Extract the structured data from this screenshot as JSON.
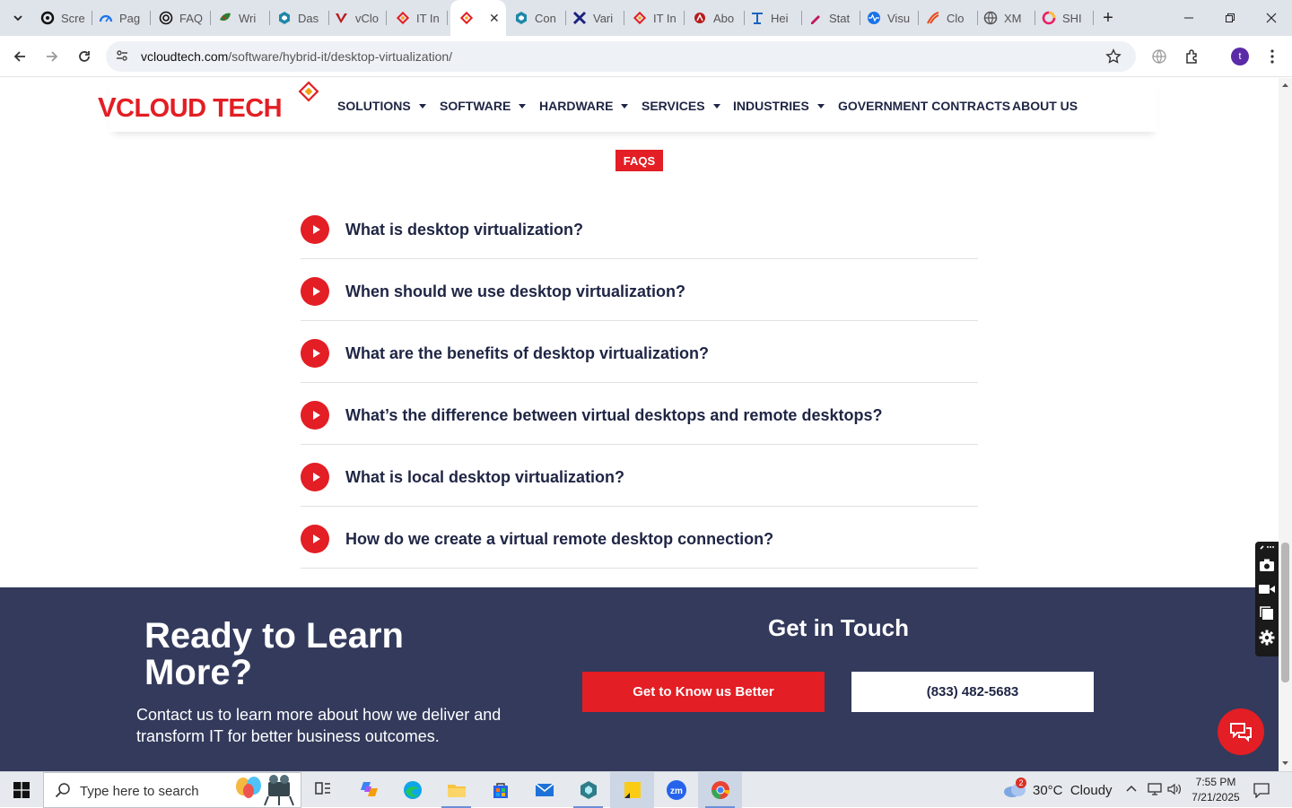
{
  "browser": {
    "tabs": [
      {
        "title": "Scre",
        "icon": "circle-ring-icon",
        "color": "#111111"
      },
      {
        "title": "Pag",
        "icon": "gauge-icon",
        "color": "#1a73e8"
      },
      {
        "title": "FAQ",
        "icon": "openai-icon",
        "color": "#111111"
      },
      {
        "title": "Wri",
        "icon": "leaf-icon",
        "color": "#2e7d32"
      },
      {
        "title": "Das",
        "icon": "hex-icon",
        "color": "#1e88a8"
      },
      {
        "title": "vClo",
        "icon": "v-logo-icon",
        "color": "#b71c1c"
      },
      {
        "title": "IT In",
        "icon": "diamond-logo-icon",
        "color": "#e31e24"
      },
      {
        "title": "",
        "icon": "diamond-logo-icon",
        "color": "#e31e24",
        "active": true
      },
      {
        "title": "Con",
        "icon": "hex-icon",
        "color": "#1e88a8"
      },
      {
        "title": "Vari",
        "icon": "x-logo-icon",
        "color": "#1a237e"
      },
      {
        "title": "IT In",
        "icon": "diamond-logo-icon",
        "color": "#e31e24"
      },
      {
        "title": "Abo",
        "icon": "brand-icon",
        "color": "#b71c1c"
      },
      {
        "title": "Hei",
        "icon": "heading-icon",
        "color": "#1565c0"
      },
      {
        "title": "Stat",
        "icon": "pen-icon",
        "color": "#c2185b"
      },
      {
        "title": "Visu",
        "icon": "pulse-icon",
        "color": "#1a73e8"
      },
      {
        "title": "Clo",
        "icon": "swoosh-icon",
        "color": "#e64a19"
      },
      {
        "title": "XM",
        "icon": "globe-icon",
        "color": "#555555"
      },
      {
        "title": "SHI",
        "icon": "ring-icon",
        "color": "#e91e63"
      }
    ],
    "close_tab_glyph": "✕",
    "new_tab_glyph": "+",
    "url_host": "vcloudtech.com",
    "url_path": "/software/hybrid-it/desktop-virtualization/",
    "profile_initial": "t"
  },
  "site": {
    "logo_text_v": "V",
    "logo_text": "CLOUD TECH",
    "nav": [
      {
        "label": "SOLUTIONS",
        "dropdown": true
      },
      {
        "label": "SOFTWARE",
        "dropdown": true
      },
      {
        "label": "HARDWARE",
        "dropdown": true
      },
      {
        "label": "SERVICES",
        "dropdown": true
      },
      {
        "label": "INDUSTRIES",
        "dropdown": true
      },
      {
        "label": "GOVERNMENT CONTRACTS",
        "dropdown": false
      },
      {
        "label": "ABOUT US",
        "dropdown": false
      }
    ],
    "faq_badge": "FAQS",
    "faqs": [
      "What is desktop virtualization?",
      "When should we use desktop virtualization?",
      "What are the benefits of desktop virtualization?",
      "What’s the difference between virtual desktops and remote desktops?",
      "What is local desktop virtualization?",
      "How do we create a virtual remote desktop connection?"
    ],
    "footer": {
      "heading": "Ready to Learn More?",
      "subtext": "Contact us to learn more about how we deliver and transform IT for better business outcomes.",
      "get_in_touch": "Get in Touch",
      "cta_primary": "Get to Know us Better",
      "cta_phone": "(833) 482-5683"
    },
    "accent_color": "#e31e24",
    "navy_color": "#333a5c"
  },
  "taskbar": {
    "search_placeholder": "Type here to search",
    "apps": [
      "task-view-icon",
      "copilot-icon",
      "edge-icon",
      "file-explorer-icon",
      "store-icon",
      "mail-icon",
      "app-hex-icon",
      "sticky-notes-icon",
      "zoom-icon",
      "chrome-icon"
    ],
    "weather_badge": "2",
    "weather": "30°C  Cloudy",
    "time": "7:55 PM",
    "date": "7/21/2025"
  }
}
